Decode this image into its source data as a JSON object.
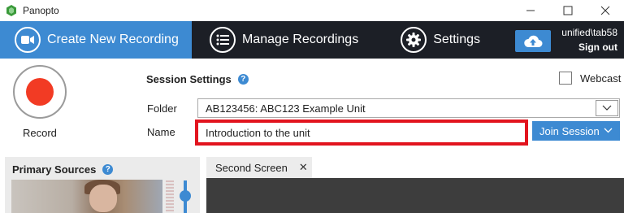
{
  "window": {
    "title": "Panopto",
    "minimize_icon": "minimize-icon",
    "maximize_icon": "maximize-icon",
    "close_icon": "close-icon"
  },
  "nav": {
    "create_label": "Create New Recording",
    "manage_label": "Manage Recordings",
    "settings_label": "Settings",
    "upload_icon": "cloud-upload-icon",
    "user": "unified\\tab58",
    "signout_label": "Sign out"
  },
  "record": {
    "label": "Record",
    "dot_color": "#f23b24"
  },
  "session": {
    "title": "Session Settings",
    "help": "?",
    "webcast_label": "Webcast",
    "webcast_checked": false,
    "folder_label": "Folder",
    "folder_value": "AB123456: ABC123 Example Unit",
    "name_label": "Name",
    "name_value": "Introduction to the unit",
    "join_label": "Join Session"
  },
  "sources": {
    "title": "Primary Sources",
    "help": "?"
  },
  "second_screen": {
    "tab_label": "Second Screen",
    "close": "✕"
  },
  "colors": {
    "accent": "#3d8ad2",
    "nav_bg": "#1c1f26",
    "highlight": "#e2141e"
  }
}
